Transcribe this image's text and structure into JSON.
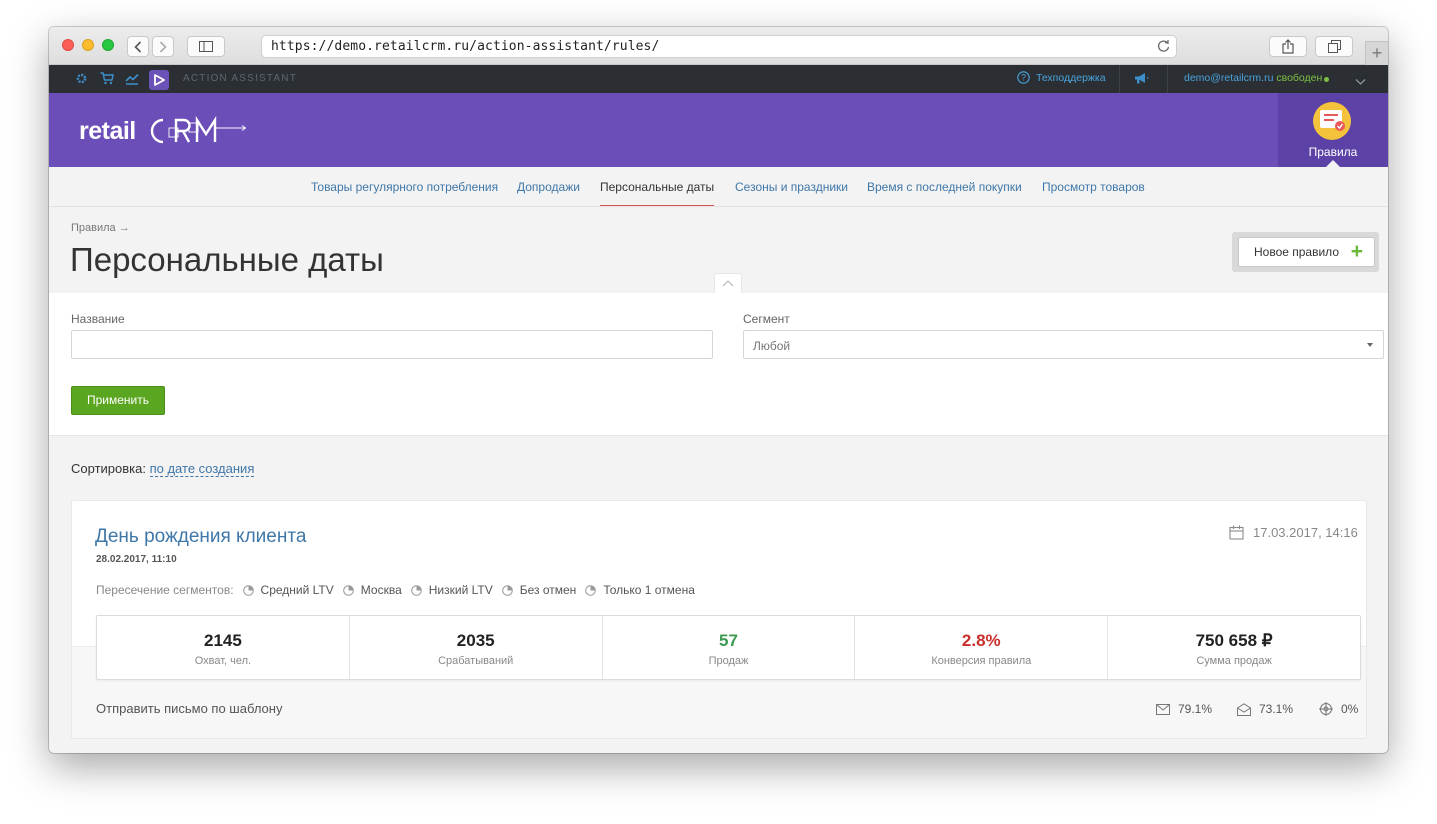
{
  "browser": {
    "url": "https://demo.retailcrm.ru/action-assistant/rules/"
  },
  "topbar": {
    "section_label": "ACTION ASSISTANT",
    "support_label": "Техподдержка",
    "user_email": "demo@retailcrm.ru",
    "user_status": "свободен",
    "status_color": "#7bc043"
  },
  "header": {
    "logo_text": "retailCRM",
    "brand_color": "#6b4eb8",
    "tile_label": "Правила"
  },
  "tabs": [
    {
      "label": "Товары регулярного потребления",
      "active": false
    },
    {
      "label": "Допродажи",
      "active": false
    },
    {
      "label": "Персональные даты",
      "active": true
    },
    {
      "label": "Сезоны и праздники",
      "active": false
    },
    {
      "label": "Время с последней покупки",
      "active": false
    },
    {
      "label": "Просмотр товаров",
      "active": false
    }
  ],
  "page": {
    "breadcrumb": "Правила →",
    "title": "Персональные даты",
    "new_rule_label": "Новое правило"
  },
  "filters": {
    "name_label": "Название",
    "name_value": "",
    "segment_label": "Сегмент",
    "segment_value": "Любой",
    "apply_label": "Применить"
  },
  "sort": {
    "label": "Сортировка:",
    "value": "по дате создания"
  },
  "rule": {
    "title": "День рождения клиента",
    "created": "28.02.2017, 11:10",
    "updated": "17.03.2017, 14:16",
    "segments_label": "Пересечение сегментов:",
    "segments": [
      "Средний LTV",
      "Москва",
      "Низкий LTV",
      "Без отмен",
      "Только 1 отмена"
    ],
    "stats": [
      {
        "value": "2145",
        "label": "Охват, чел.",
        "tone": "normal"
      },
      {
        "value": "2035",
        "label": "Срабатываний",
        "tone": "normal"
      },
      {
        "value": "57",
        "label": "Продаж",
        "tone": "green"
      },
      {
        "value": "2.8%",
        "label": "Конверсия правила",
        "tone": "red"
      },
      {
        "value": "750 658 ₽",
        "label": "Сумма продаж",
        "tone": "normal"
      }
    ],
    "action": "Отправить письмо по шаблону",
    "metrics": {
      "delivered": "79.1%",
      "opened": "73.1%",
      "clicked": "0%"
    }
  }
}
